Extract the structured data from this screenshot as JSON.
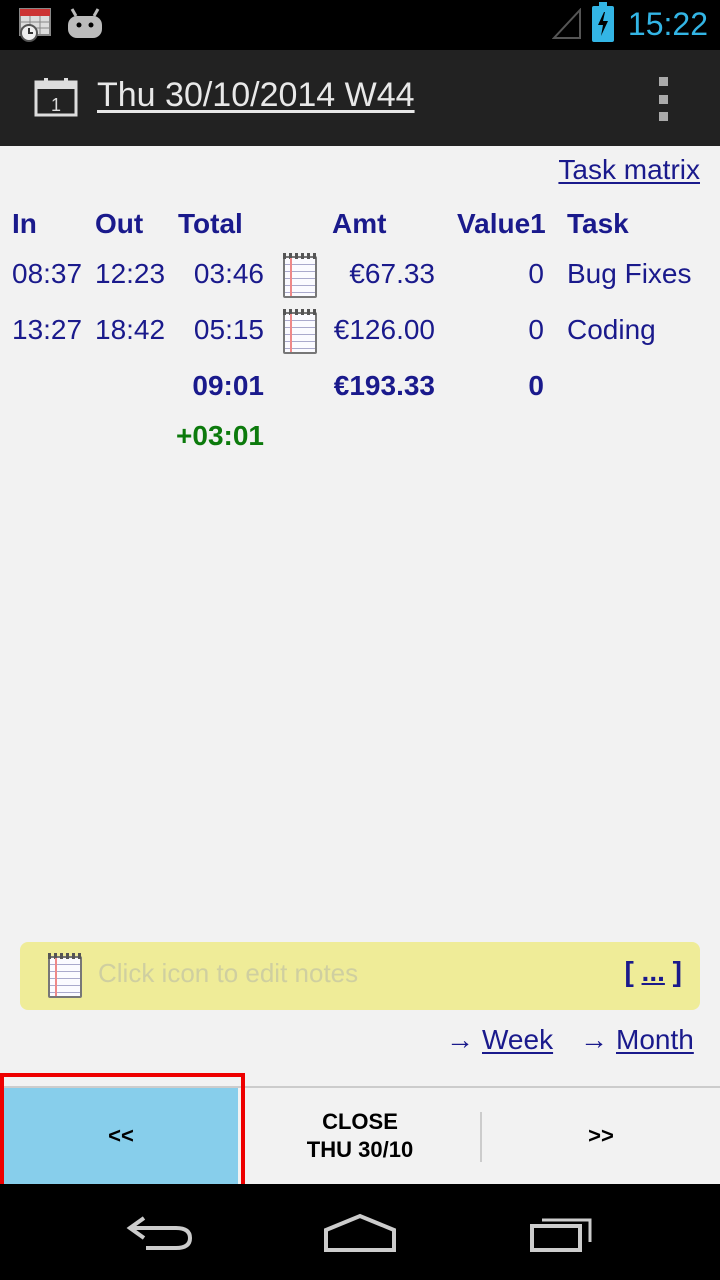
{
  "status_bar": {
    "time": "15:22",
    "accent": "#33b5e5"
  },
  "action_bar": {
    "title": "Thu 30/10/2014 W44",
    "calendar_icon": "calendar-icon",
    "overflow_icon": "overflow-menu-icon"
  },
  "task_matrix_label": "Task matrix",
  "table": {
    "headers": {
      "in": "In",
      "out": "Out",
      "total": "Total",
      "amt": "Amt",
      "value1": "Value1",
      "task": "Task"
    },
    "rows": [
      {
        "in": "08:37",
        "out": "12:23",
        "total": "03:46",
        "amt": "€67.33",
        "value1": "0",
        "task": "Bug Fixes"
      },
      {
        "in": "13:27",
        "out": "18:42",
        "total": "05:15",
        "amt": "€126.00",
        "value1": "0",
        "task": "Coding"
      }
    ],
    "totals": {
      "total": "09:01",
      "amt": "€193.33",
      "value1": "0"
    },
    "overtime": "+03:01"
  },
  "notes": {
    "placeholder": "Click icon to edit notes",
    "more_open": "[",
    "more_dots": "...",
    "more_close": "]"
  },
  "nav_links": {
    "arrow": "→",
    "week": "Week",
    "month": "Month"
  },
  "buttons": {
    "prev": "<<",
    "close_line1": "CLOSE",
    "close_line2": "THU 30/10",
    "next": ">>"
  },
  "colors": {
    "link_text": "#1a1a8c",
    "overtime": "#0c7a0c",
    "notes_bg": "#efec98",
    "selected_button": "#87ceeb",
    "highlight": "#e00000"
  }
}
